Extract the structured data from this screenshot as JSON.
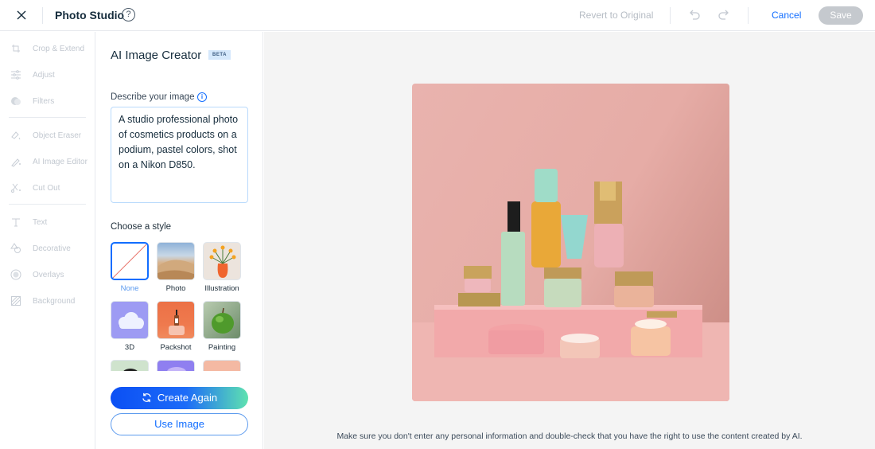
{
  "header": {
    "title": "Photo Studio",
    "revert_label": "Revert to Original",
    "cancel_label": "Cancel",
    "save_label": "Save"
  },
  "sidebar": {
    "items": [
      {
        "label": "Crop & Extend",
        "icon": "crop-icon"
      },
      {
        "label": "Adjust",
        "icon": "sliders-icon"
      },
      {
        "label": "Filters",
        "icon": "filters-icon"
      },
      {
        "label": "Object Eraser",
        "icon": "eraser-icon"
      },
      {
        "label": "AI Image Editor",
        "icon": "ai-brush-icon"
      },
      {
        "label": "Cut Out",
        "icon": "scissors-icon"
      },
      {
        "label": "Text",
        "icon": "text-icon"
      },
      {
        "label": "Decorative",
        "icon": "shapes-icon"
      },
      {
        "label": "Overlays",
        "icon": "overlays-icon"
      },
      {
        "label": "Background",
        "icon": "background-icon"
      }
    ]
  },
  "panel": {
    "title": "AI Image Creator",
    "badge": "BETA",
    "describe_label": "Describe your image",
    "description": "A studio professional photo of cosmetics products on a podium, pastel colors, shot on a Nikon D850.",
    "style_label": "Choose a style",
    "styles": [
      {
        "name": "None",
        "selected": true
      },
      {
        "name": "Photo",
        "selected": false
      },
      {
        "name": "Illustration",
        "selected": false
      },
      {
        "name": "3D",
        "selected": false
      },
      {
        "name": "Packshot",
        "selected": false
      },
      {
        "name": "Painting",
        "selected": false
      }
    ],
    "create_label": "Create Again",
    "use_label": "Use Image"
  },
  "canvas": {
    "image_alt": "Cosmetics products on a pink podium, pastel colors",
    "disclaimer": "Make sure you don't enter any personal information and double-check that you have the right to use the content created by AI."
  },
  "colors": {
    "accent": "#116dff",
    "disabled": "#c5c9ce"
  }
}
